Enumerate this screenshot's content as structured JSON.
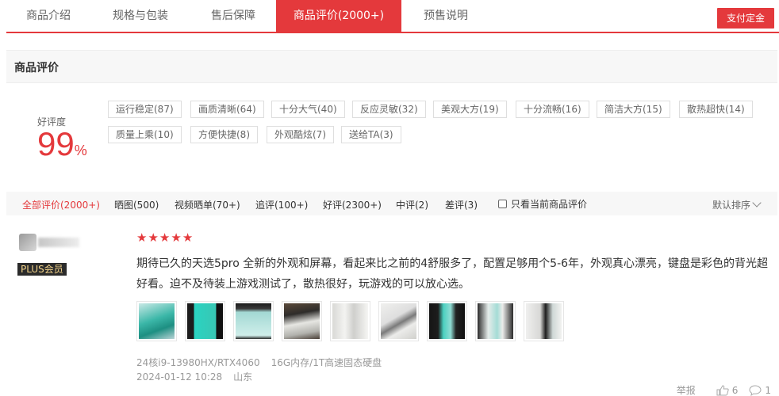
{
  "tabs": [
    {
      "label": "商品介绍",
      "active": false
    },
    {
      "label": "规格与包装",
      "active": false
    },
    {
      "label": "售后保障",
      "active": false
    },
    {
      "label": "商品评价(2000+)",
      "active": true
    },
    {
      "label": "预售说明",
      "active": false
    }
  ],
  "pay_button": "支付定金",
  "section_title": "商品评价",
  "rating": {
    "label": "好评度",
    "value": "99",
    "unit": "%"
  },
  "tags": [
    "运行稳定(87)",
    "画质清晰(64)",
    "十分大气(40)",
    "反应灵敏(32)",
    "美观大方(19)",
    "十分流畅(16)",
    "简洁大方(15)",
    "散热超快(14)",
    "质量上乘(10)",
    "方便快捷(8)",
    "外观酷炫(7)",
    "送给TA(3)"
  ],
  "filters": [
    {
      "label": "全部评价(2000+)",
      "active": true
    },
    {
      "label": "晒图(500)",
      "active": false
    },
    {
      "label": "视频晒单(70+)",
      "active": false
    },
    {
      "label": "追评(100+)",
      "active": false
    },
    {
      "label": "好评(2300+)",
      "active": false
    },
    {
      "label": "中评(2)",
      "active": false
    },
    {
      "label": "差评(3)",
      "active": false
    }
  ],
  "checkbox_label": "只看当前商品评价",
  "sort_label": "默认排序",
  "review": {
    "badge": "PLUS会员",
    "stars": 5,
    "content": "期待已久的天选5pro 全新的外观和屏幕，看起来比之前的4舒服多了，配置足够用个5-6年，外观真心漂亮，键盘是彩色的背光超好看。迫不及待装上游戏测试了，散热很好，玩游戏的可以放心选。",
    "spec_cpu": "24核i9-13980HX/RTX4060",
    "spec_mem": "16G内存/1T高速固态硬盘",
    "date": "2024-01-12 10:28",
    "location": "山东",
    "report": "举报",
    "likes": "6",
    "replies": "1"
  },
  "colors": {
    "accent": "#e4393c",
    "plus_gold": "#f4d48a"
  }
}
